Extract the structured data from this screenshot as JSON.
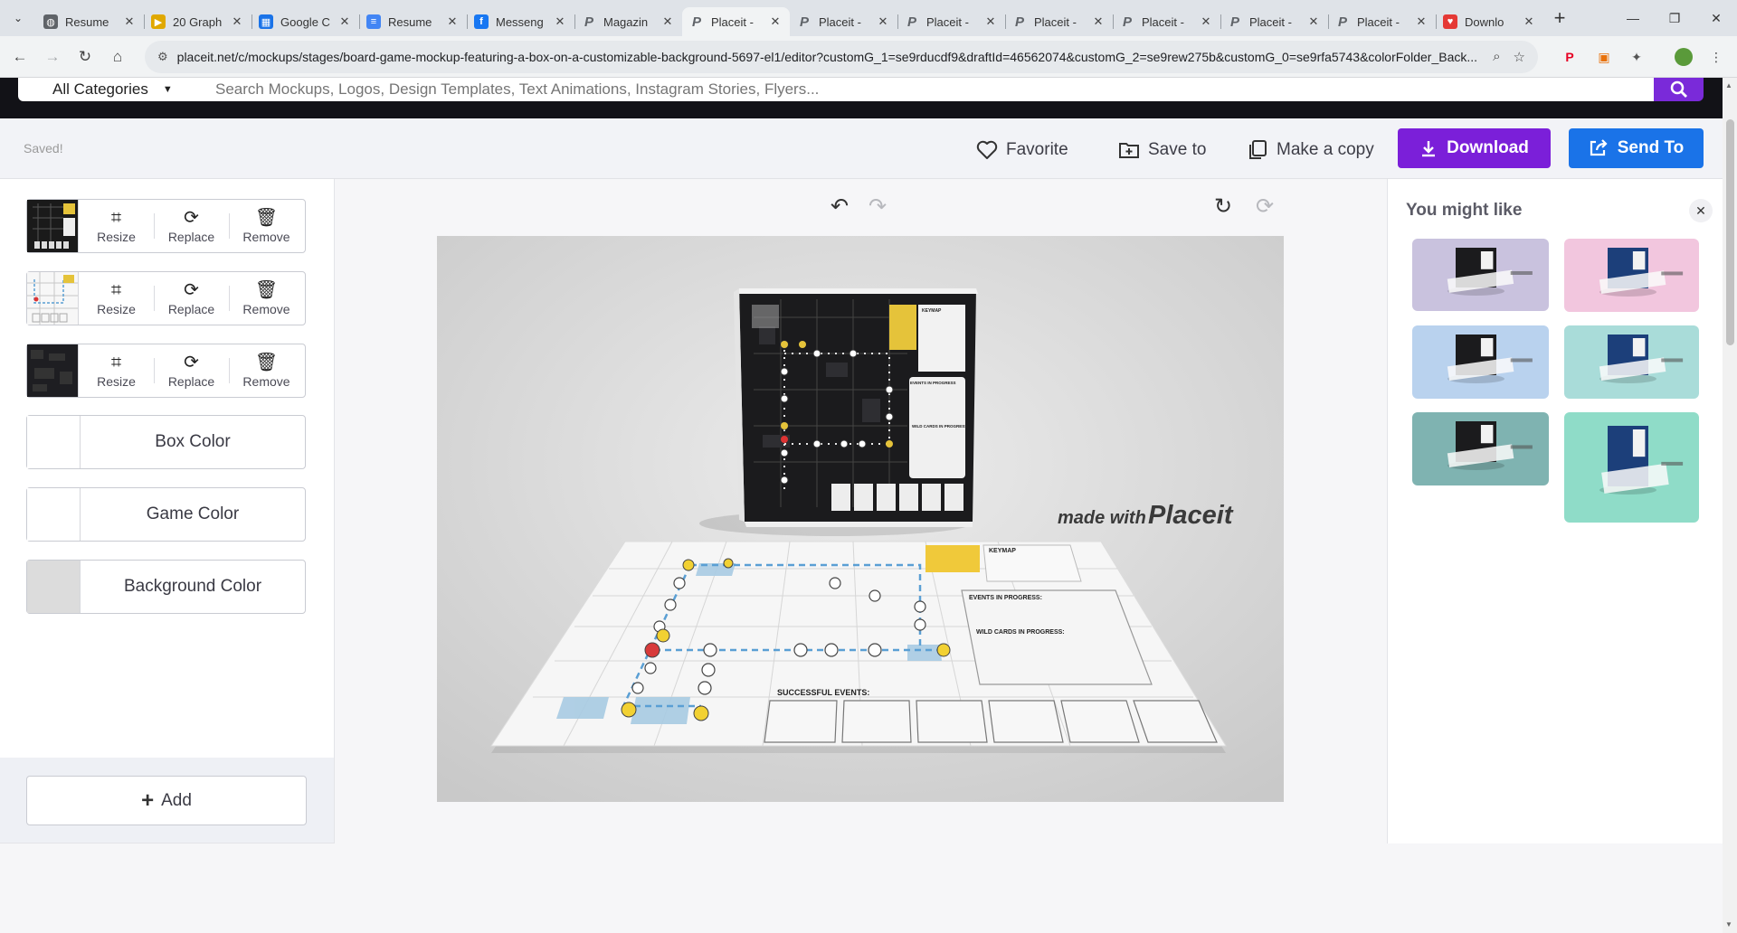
{
  "browser": {
    "tabs": [
      {
        "title": "Resume",
        "icon": "globe-icon",
        "color": "#5f6368",
        "glyph": "◍"
      },
      {
        "title": "20 Graph",
        "icon": "play-icon",
        "color": "#e0a800",
        "glyph": "▶"
      },
      {
        "title": "Google C",
        "icon": "calendar-icon",
        "color": "#1a73e8",
        "glyph": "▦"
      },
      {
        "title": "Resume",
        "icon": "docs-icon",
        "color": "#4285f4",
        "glyph": "≡"
      },
      {
        "title": "Messeng",
        "icon": "facebook-icon",
        "color": "#1877f2",
        "glyph": "f"
      },
      {
        "title": "Magazin",
        "icon": "placeit-icon",
        "color": "#5f6368",
        "glyph": "P"
      },
      {
        "title": "Placeit -",
        "icon": "placeit-icon",
        "color": "#5f6368",
        "glyph": "P",
        "active": true
      },
      {
        "title": "Placeit -",
        "icon": "placeit-icon",
        "color": "#5f6368",
        "glyph": "P"
      },
      {
        "title": "Placeit -",
        "icon": "placeit-icon",
        "color": "#5f6368",
        "glyph": "P"
      },
      {
        "title": "Placeit -",
        "icon": "placeit-icon",
        "color": "#5f6368",
        "glyph": "P"
      },
      {
        "title": "Placeit -",
        "icon": "placeit-icon",
        "color": "#5f6368",
        "glyph": "P"
      },
      {
        "title": "Placeit -",
        "icon": "placeit-icon",
        "color": "#5f6368",
        "glyph": "P"
      },
      {
        "title": "Placeit -",
        "icon": "placeit-icon",
        "color": "#5f6368",
        "glyph": "P"
      },
      {
        "title": "Downlo",
        "icon": "heart-shield-icon",
        "color": "#e53935",
        "glyph": "♥"
      }
    ],
    "tab_close": "✕",
    "new_tab": "+",
    "url": "placeit.net/c/mockups/stages/board-game-mockup-featuring-a-box-on-a-customizable-background-5697-el1/editor?customG_1=se9rducdf9&draftId=46562074&customG_2=se9rew275b&customG_0=se9rfa5743&colorFolder_Back..."
  },
  "site": {
    "category_select": "All Categories",
    "search_placeholder": "Search Mockups, Logos, Design Templates, Text Animations, Instagram Stories, Flyers..."
  },
  "toolbar": {
    "status": "Saved!",
    "favorite_label": "Favorite",
    "save_to_label": "Save to",
    "make_copy_label": "Make a copy",
    "download_label": "Download",
    "send_to_label": "Send To"
  },
  "layers": [
    {
      "resize": "Resize",
      "replace": "Replace",
      "remove": "Remove"
    },
    {
      "resize": "Resize",
      "replace": "Replace",
      "remove": "Remove"
    },
    {
      "resize": "Resize",
      "replace": "Replace",
      "remove": "Remove"
    }
  ],
  "colors": [
    {
      "label": "Box Color",
      "swatch": "#ffffff"
    },
    {
      "label": "Game Color",
      "swatch": "#ffffff"
    },
    {
      "label": "Background Color",
      "swatch": "#dcdcdc"
    }
  ],
  "add_label": "Add",
  "mockup": {
    "watermark_prefix": "made with",
    "watermark_brand": "Placeit",
    "board_events": "EVENTS IN PROGRESS:",
    "board_wild": "WILD CARDS IN PROGRESS:",
    "board_success": "SUCCESSFUL EVENTS:",
    "board_keymap": "KEYMAP",
    "box_events": "EVENTS IN PROGRESS",
    "box_wild": "WILD CARDS IN PROGRESS"
  },
  "suggestions": {
    "title": "You might like",
    "close": "✕",
    "items": [
      {
        "name": "suggestion-lavender",
        "bg": "#c9c2de"
      },
      {
        "name": "suggestion-pink",
        "bg": "#f2c6de"
      },
      {
        "name": "suggestion-light-blue",
        "bg": "#b9d2ee"
      },
      {
        "name": "suggestion-aqua",
        "bg": "#a9dcd9"
      },
      {
        "name": "suggestion-teal",
        "bg": "#7fb3b1"
      },
      {
        "name": "suggestion-mint",
        "bg": "#8fdcc8"
      }
    ]
  },
  "accent": {
    "purple": "#7b1fd9",
    "blue": "#1a73e8"
  }
}
